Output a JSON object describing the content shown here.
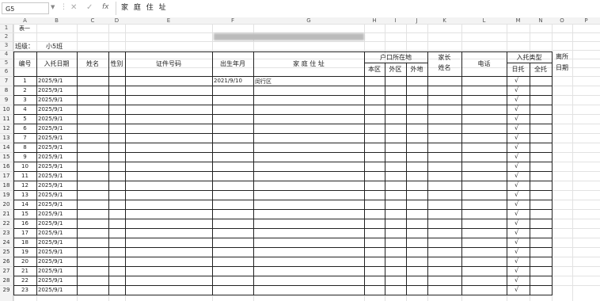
{
  "formula_bar": {
    "name_box": "G5",
    "fx_label": "fx",
    "formula": "家 庭 住 址"
  },
  "columns": [
    "A",
    "B",
    "C",
    "D",
    "E",
    "F",
    "G",
    "H",
    "I",
    "J",
    "K",
    "L",
    "M",
    "N",
    "O",
    "P"
  ],
  "sheet": {
    "title": "表一",
    "class_label": "班级：",
    "class_value": "小5班",
    "headers": {
      "no": "编号",
      "entry_date": "入托日期",
      "name": "姓名",
      "gender": "性别",
      "id_no": "证件号码",
      "birth": "出生年月",
      "address": "家 庭 住 址",
      "hukou": "户口所在地",
      "hukou_local": "本区",
      "hukou_other": "外区",
      "hukou_outside": "外地",
      "parent_name_1": "家长",
      "parent_name_2": "姓名",
      "phone": "电话",
      "care_type": "入托类型",
      "day_care": "日托",
      "full_care": "全托",
      "leave_1": "离所",
      "leave_2": "日期"
    },
    "first_row_extra": {
      "birth": "2021/9/10",
      "address": "闵行区"
    },
    "rows": [
      {
        "row": "7",
        "no": "1",
        "date": "2025/9/1"
      },
      {
        "row": "8",
        "no": "2",
        "date": "2025/9/1"
      },
      {
        "row": "9",
        "no": "3",
        "date": "2025/9/1"
      },
      {
        "row": "10",
        "no": "4",
        "date": "2025/9/1"
      },
      {
        "row": "11",
        "no": "5",
        "date": "2025/9/1"
      },
      {
        "row": "12",
        "no": "6",
        "date": "2025/9/1"
      },
      {
        "row": "13",
        "no": "7",
        "date": "2025/9/1"
      },
      {
        "row": "14",
        "no": "8",
        "date": "2025/9/1"
      },
      {
        "row": "15",
        "no": "9",
        "date": "2025/9/1"
      },
      {
        "row": "16",
        "no": "10",
        "date": "2025/9/1"
      },
      {
        "row": "17",
        "no": "11",
        "date": "2025/9/1"
      },
      {
        "row": "18",
        "no": "12",
        "date": "2025/9/1"
      },
      {
        "row": "19",
        "no": "13",
        "date": "2025/9/1"
      },
      {
        "row": "20",
        "no": "14",
        "date": "2025/9/1"
      },
      {
        "row": "21",
        "no": "15",
        "date": "2025/9/1"
      },
      {
        "row": "22",
        "no": "16",
        "date": "2025/9/1"
      },
      {
        "row": "23",
        "no": "17",
        "date": "2025/9/1"
      },
      {
        "row": "24",
        "no": "18",
        "date": "2025/9/1"
      },
      {
        "row": "25",
        "no": "19",
        "date": "2025/9/1"
      },
      {
        "row": "26",
        "no": "20",
        "date": "2025/9/1"
      },
      {
        "row": "27",
        "no": "21",
        "date": "2025/9/1"
      },
      {
        "row": "28",
        "no": "22",
        "date": "2025/9/1"
      },
      {
        "row": "29",
        "no": "23",
        "date": "2025/9/1"
      }
    ],
    "check_mark": "√",
    "row_numbers_top": [
      "1",
      "2",
      "3",
      "4",
      "5",
      "6"
    ]
  }
}
